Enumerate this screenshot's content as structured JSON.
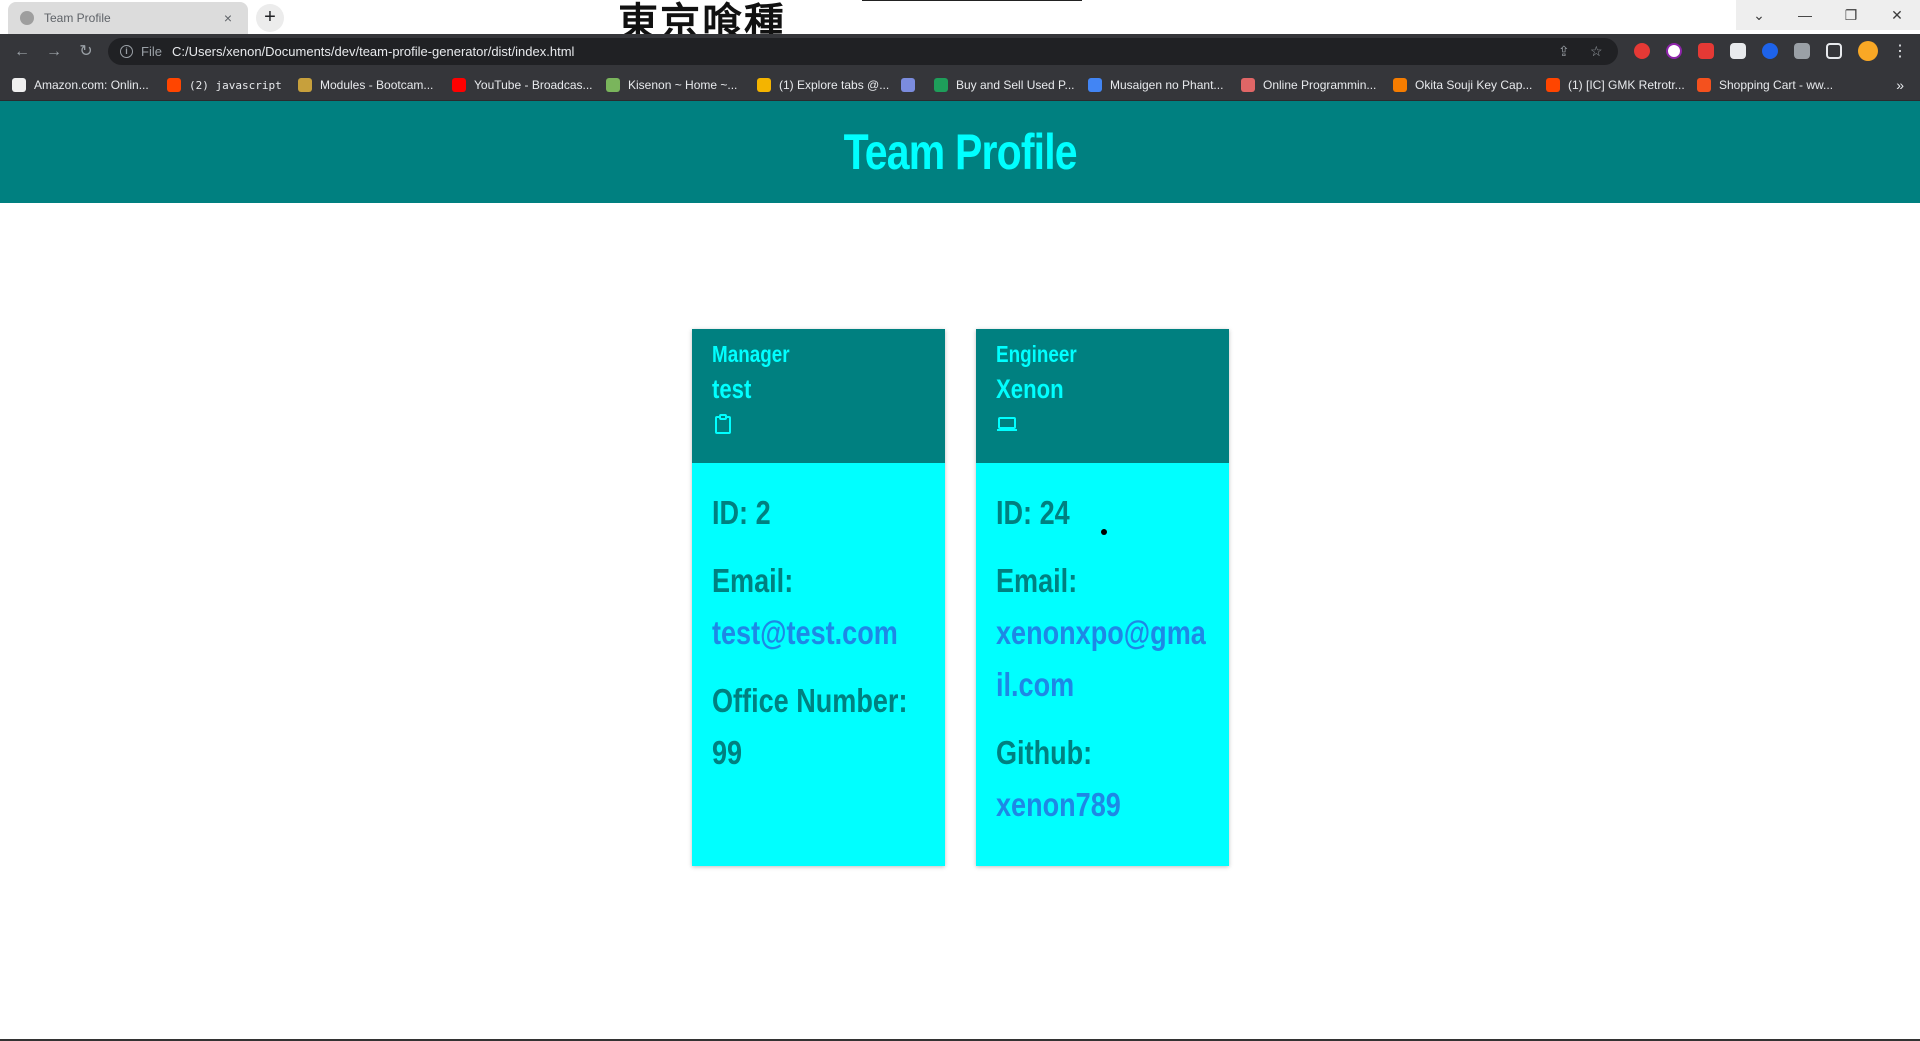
{
  "browser": {
    "tab_title": "Team Profile",
    "tab_close": "×",
    "new_tab": "+",
    "title_deco_text": "東京喰種",
    "window_controls": [
      "⌄",
      "—",
      "❐",
      "✕"
    ],
    "nav": {
      "back": "←",
      "forward": "→",
      "reload": "↻"
    },
    "address": {
      "scheme": "File",
      "url": "C:/Users/xenon/Documents/dev/team-profile-generator/dist/index.html"
    },
    "bookmarks": [
      {
        "label": "Amazon.com: Onlin...",
        "icon_color": "#f0f0f0"
      },
      {
        "label": "(2) javascript",
        "icon_color": "#ff4500"
      },
      {
        "label": "Modules - Bootcam...",
        "icon_color": "#c7a03c"
      },
      {
        "label": "YouTube - Broadcas...",
        "icon_color": "#ff0000"
      },
      {
        "label": "Kisenon ~ Home ~...",
        "icon_color": "#7ab55c"
      },
      {
        "label": "(1) Explore tabs @...",
        "icon_color": "#f4b400"
      },
      {
        "label": "",
        "icon_color": "#7b8cde"
      },
      {
        "label": "Buy and Sell Used P...",
        "icon_color": "#1e9e5a"
      },
      {
        "label": "Musaigen no Phant...",
        "icon_color": "#4285f4"
      },
      {
        "label": "Online Programmin...",
        "icon_color": "#e06666"
      },
      {
        "label": "Okita Souji Key Cap...",
        "icon_color": "#f57c00"
      },
      {
        "label": "(1) [IC] GMK Retrotr...",
        "icon_color": "#ff4500"
      },
      {
        "label": "Shopping Cart - ww...",
        "icon_color": "#f4511e"
      }
    ],
    "bookmarks_more": "»"
  },
  "page": {
    "title": "Team Profile",
    "cards": [
      {
        "role": "Manager",
        "name": "test",
        "icon": "clipboard-icon",
        "id_text": "ID: 2",
        "email_label": "Email:",
        "email": "test@test.com",
        "extra_label": "Office Number:",
        "extra_value": "99"
      },
      {
        "role": "Engineer",
        "name": "Xenon",
        "icon": "laptop-icon",
        "id_text": "ID: 24",
        "email_label": "Email:",
        "email": "xenonxpo@gmail.com",
        "extra_label": "Github:",
        "extra_value": "xenon789"
      }
    ]
  },
  "colors": {
    "header_bg": "#008080",
    "accent": "#00ffff",
    "link": "#1e88e5"
  }
}
